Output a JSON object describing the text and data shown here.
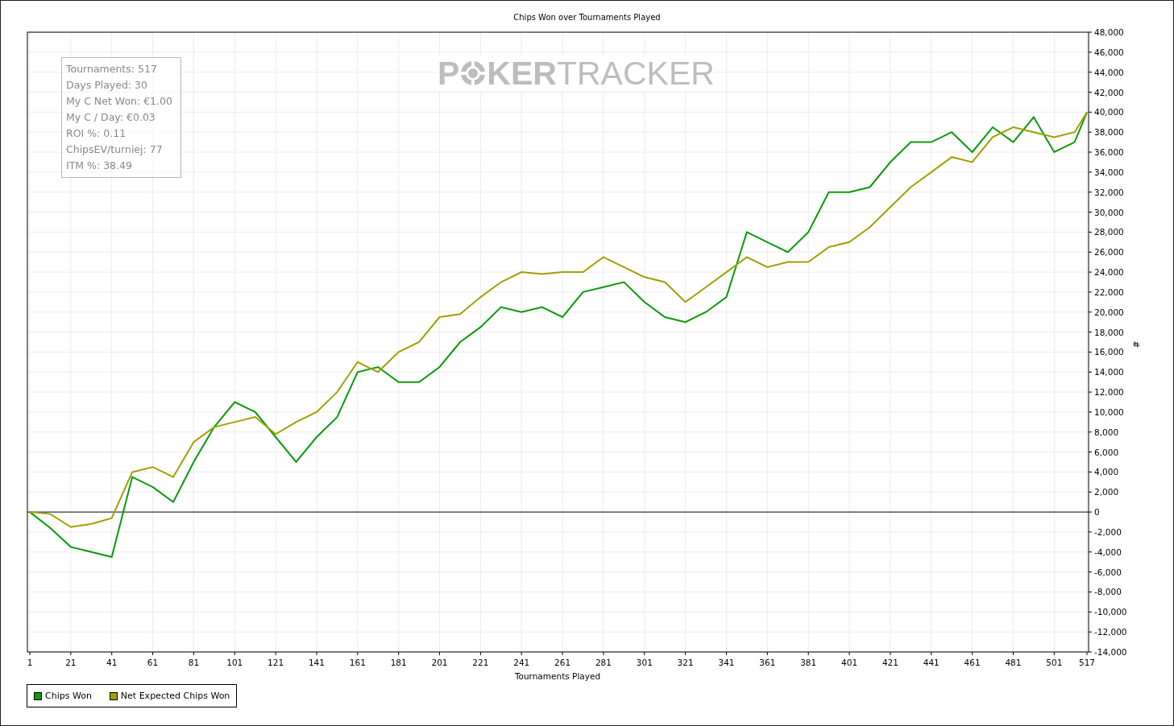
{
  "title": "Chips Won over Tournaments Played",
  "watermark": {
    "parts": [
      "P",
      "KER",
      "TRACKER"
    ]
  },
  "stats": [
    "Tournaments: 517",
    "Days Played: 30",
    "My C Net Won: €1.00",
    "My C / Day: €0.03",
    "ROI %: 0.11",
    "ChipsEV/turniej: 77",
    "ITM %: 38.49"
  ],
  "chart_data": {
    "type": "line",
    "xlabel": "Tournaments Played",
    "ylabel": "#",
    "x": [
      1,
      11,
      21,
      31,
      41,
      51,
      61,
      71,
      81,
      91,
      101,
      111,
      121,
      131,
      141,
      151,
      161,
      171,
      181,
      191,
      201,
      211,
      221,
      231,
      241,
      251,
      261,
      271,
      281,
      291,
      301,
      311,
      321,
      331,
      341,
      351,
      361,
      371,
      381,
      391,
      401,
      411,
      421,
      431,
      441,
      451,
      461,
      471,
      481,
      491,
      501,
      511,
      517
    ],
    "series": [
      {
        "name": "Chips Won",
        "color": "#0a9a0a",
        "values": [
          0,
          -1600,
          -3500,
          -4000,
          -4500,
          3500,
          2500,
          1000,
          5000,
          8500,
          11000,
          10000,
          7500,
          5000,
          7500,
          9500,
          14000,
          14500,
          13000,
          13000,
          14500,
          17000,
          18500,
          20500,
          20000,
          20500,
          19500,
          22000,
          22500,
          23000,
          21000,
          19500,
          19000,
          20000,
          21500,
          28000,
          27000,
          26000,
          28000,
          32000,
          32000,
          32500,
          35000,
          37000,
          37000,
          38000,
          36000,
          38500,
          37000,
          39500,
          36000,
          37000,
          40000
        ]
      },
      {
        "name": "Net Expected Chips Won",
        "color": "#a0a000",
        "values": [
          0,
          -200,
          -1500,
          -1200,
          -600,
          4000,
          4500,
          3500,
          7000,
          8500,
          9000,
          9500,
          7800,
          9000,
          10000,
          12000,
          15000,
          14000,
          16000,
          17000,
          19500,
          19800,
          21500,
          23000,
          24000,
          23800,
          24000,
          24000,
          25500,
          24500,
          23500,
          23000,
          21000,
          22500,
          24000,
          25500,
          24500,
          25000,
          25000,
          26500,
          27000,
          28500,
          30500,
          32500,
          34000,
          35500,
          35000,
          37500,
          38500,
          38000,
          37500,
          38000,
          40000
        ]
      }
    ],
    "grid": true,
    "xlim": [
      1,
      517
    ],
    "ylim": [
      -14000,
      48000
    ],
    "xticks": [
      1,
      21,
      41,
      61,
      81,
      101,
      121,
      141,
      161,
      181,
      201,
      221,
      241,
      261,
      281,
      301,
      321,
      341,
      361,
      381,
      401,
      421,
      441,
      461,
      481,
      501,
      517
    ],
    "yticks": [
      {
        "value": 48000,
        "label": "48,000"
      },
      {
        "value": 46000,
        "label": "46,000"
      },
      {
        "value": 44000,
        "label": "44,000"
      },
      {
        "value": 42000,
        "label": "42,000"
      },
      {
        "value": 40000,
        "label": "40,000"
      },
      {
        "value": 38000,
        "label": "38,000"
      },
      {
        "value": 36000,
        "label": "36,000"
      },
      {
        "value": 34000,
        "label": "34,000"
      },
      {
        "value": 32000,
        "label": "32,000"
      },
      {
        "value": 30000,
        "label": "30,000"
      },
      {
        "value": 28000,
        "label": "28,000"
      },
      {
        "value": 26000,
        "label": "26,000"
      },
      {
        "value": 24000,
        "label": "24,000"
      },
      {
        "value": 22000,
        "label": "22,000"
      },
      {
        "value": 20000,
        "label": "20,000"
      },
      {
        "value": 18000,
        "label": "18,000"
      },
      {
        "value": 16000,
        "label": "16,000"
      },
      {
        "value": 14000,
        "label": "14,000"
      },
      {
        "value": 12000,
        "label": "12,000"
      },
      {
        "value": 10000,
        "label": "10,000"
      },
      {
        "value": 8000,
        "label": "8,000"
      },
      {
        "value": 6000,
        "label": "6,000"
      },
      {
        "value": 4000,
        "label": "4,000"
      },
      {
        "value": 2000,
        "label": "2,000"
      },
      {
        "value": 0,
        "label": "0"
      },
      {
        "value": -2000,
        "label": "-2,000"
      },
      {
        "value": -4000,
        "label": "-4,000"
      },
      {
        "value": -6000,
        "label": "-6,000"
      },
      {
        "value": -8000,
        "label": "-8,000"
      },
      {
        "value": -10000,
        "label": "-10,000"
      },
      {
        "value": -12000,
        "label": "-12,000"
      },
      {
        "value": -14000,
        "label": "-14,000"
      }
    ]
  }
}
